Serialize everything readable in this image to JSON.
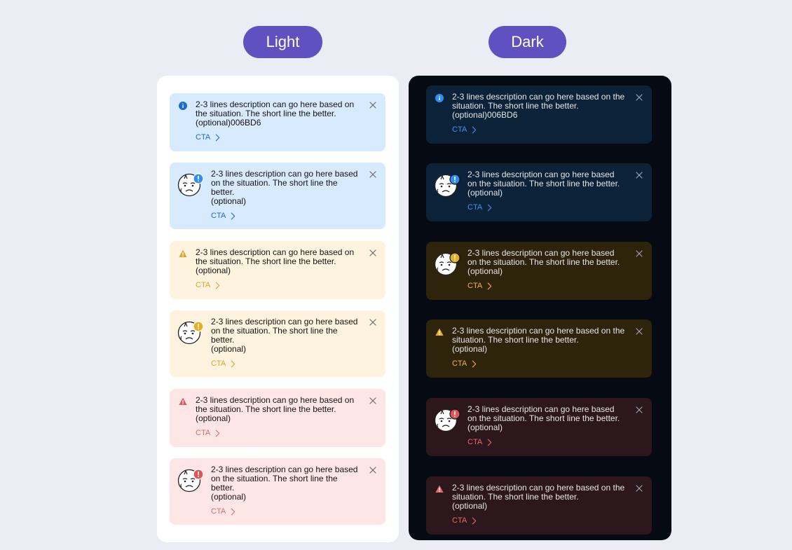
{
  "labels": {
    "light": "Light",
    "dark": "Dark"
  },
  "colors": {
    "background": "#ECECF4",
    "pill": "#6150C0",
    "info_accent": "#1B6CD0",
    "warning_accent": "#E8B020",
    "error_accent": "#E06060"
  },
  "light": {
    "cards": [
      {
        "type": "info",
        "variant": "simple",
        "icon": "info-icon",
        "desc": "2-3 lines description can go here based on\nthe situation. The short line the better.\n(optional)006BD6",
        "cta": "CTA"
      },
      {
        "type": "info",
        "variant": "avatar",
        "icon": "avatar-badge-info",
        "desc": "2-3 lines description can go here based\non the situation. The short line the\nbetter.\n(optional)",
        "cta": "CTA"
      },
      {
        "type": "warning",
        "variant": "simple",
        "icon": "warning-icon",
        "desc": "2-3 lines description can go here based on\nthe situation. The short line the better.\n(optional)",
        "cta": "CTA"
      },
      {
        "type": "warning",
        "variant": "avatar",
        "icon": "avatar-badge-warning",
        "desc": "2-3 lines description can go here based\non the situation. The short line the\nbetter.\n(optional)",
        "cta": "CTA"
      },
      {
        "type": "error",
        "variant": "simple",
        "icon": "error-icon",
        "desc": "2-3 lines description can go here based on\nthe situation. The short line the better.\n(optional)",
        "cta": "CTA"
      },
      {
        "type": "error",
        "variant": "avatar",
        "icon": "avatar-badge-error",
        "desc": "2-3 lines description can go here based\non the situation. The short line the\nbetter.\n(optional)",
        "cta": "CTA"
      }
    ]
  },
  "dark": {
    "cards": [
      {
        "type": "info",
        "variant": "simple",
        "icon": "info-icon",
        "desc": "2-3 lines description can go here based on the\nsituation. The short line the better.\n(optional)006BD6",
        "cta": "CTA"
      },
      {
        "type": "info",
        "variant": "avatar",
        "icon": "avatar-badge-info",
        "desc": "2-3 lines description can go here based\non the situation. The short line the better.\n(optional)",
        "cta": "CTA"
      },
      {
        "type": "warning",
        "variant": "avatar",
        "icon": "avatar-badge-warning",
        "desc": "2-3 lines description can go here based\non the situation. The short line the better.\n(optional)",
        "cta": "CTA"
      },
      {
        "type": "warning",
        "variant": "simple",
        "icon": "warning-icon",
        "desc": "2-3 lines description can go here based on the\nsituation. The short line the better.\n(optional)",
        "cta": "CTA"
      },
      {
        "type": "error",
        "variant": "avatar",
        "icon": "avatar-badge-error",
        "desc": "2-3 lines description can go here based\non the situation. The short line the better.\n(optional)",
        "cta": "CTA"
      },
      {
        "type": "error",
        "variant": "simple",
        "icon": "error-icon",
        "desc": "2-3 lines description can go here based on the\nsituation. The short line the better.\n(optional)",
        "cta": "CTA"
      }
    ]
  }
}
